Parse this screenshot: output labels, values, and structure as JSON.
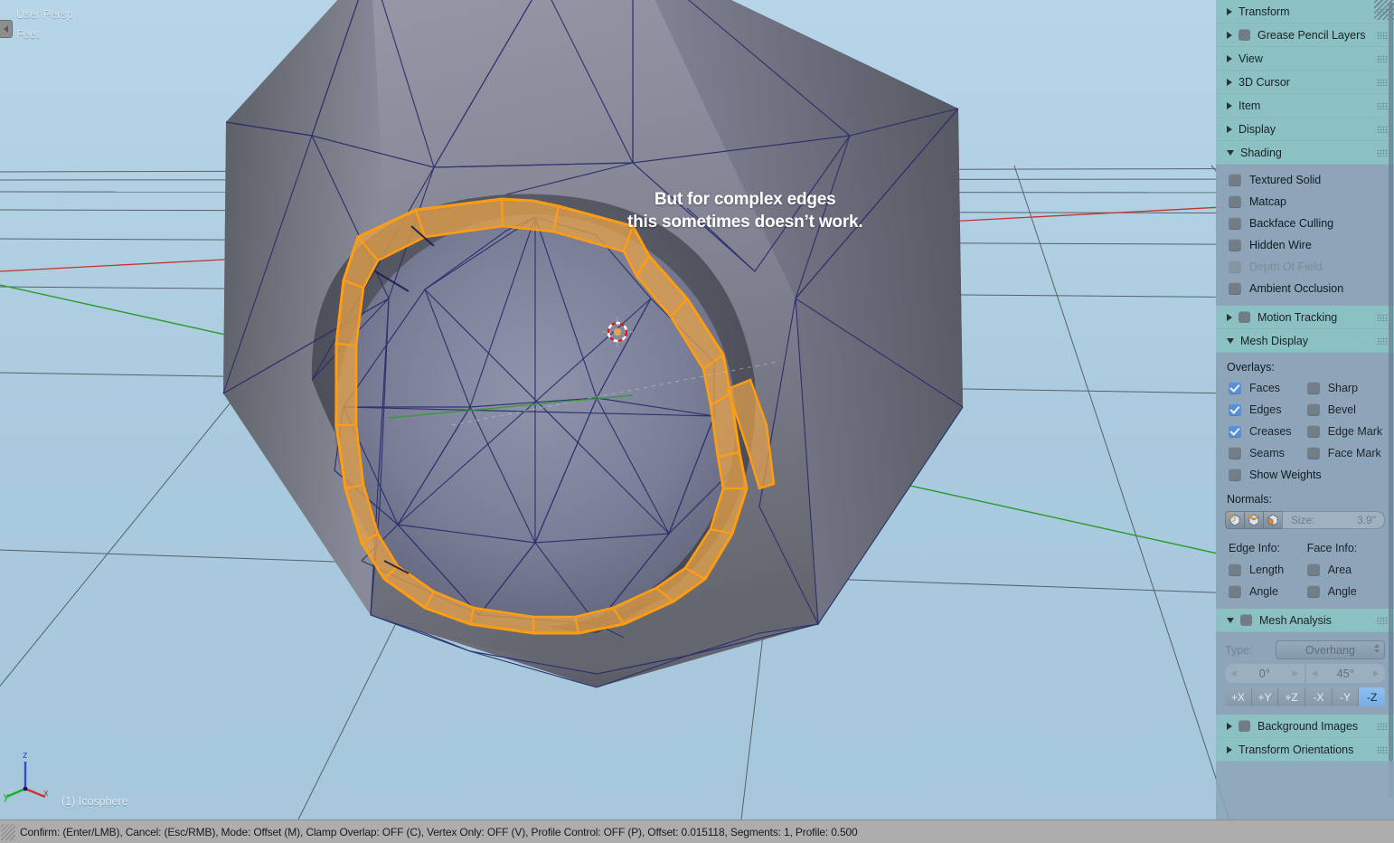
{
  "viewport": {
    "perspective_label": "User Persp",
    "units_label": "Feet",
    "object_name": "(1) Icosphere",
    "annotation_line1": "But for complex edges",
    "annotation_line2": "this sometimes doesn’t work.",
    "axis_gizmo": {
      "x": "x",
      "y": "y",
      "z": "z"
    },
    "colors": {
      "background_top": "#b7d5e9",
      "background_bottom": "#a6c7dc",
      "grid_line": "#4a4f52",
      "axis_x": "#c4332f",
      "axis_y": "#2e9c2e",
      "mesh_fill_light": "#8f92a3",
      "mesh_fill_dark": "#4e5059",
      "wire_edge": "#2a2f6b",
      "selected_edge": "#ff9d12",
      "selected_face": "#e8a34a"
    }
  },
  "properties_panel": {
    "panels": [
      {
        "name": "transform",
        "label": "Transform",
        "expanded": false,
        "has_checkbox": false
      },
      {
        "name": "grease-pencil-layers",
        "label": "Grease Pencil Layers",
        "expanded": false,
        "has_checkbox": true
      },
      {
        "name": "view",
        "label": "View",
        "expanded": false,
        "has_checkbox": false
      },
      {
        "name": "3d-cursor",
        "label": "3D Cursor",
        "expanded": false,
        "has_checkbox": false
      },
      {
        "name": "item",
        "label": "Item",
        "expanded": false,
        "has_checkbox": false
      },
      {
        "name": "display",
        "label": "Display",
        "expanded": false,
        "has_checkbox": false
      },
      {
        "name": "shading",
        "label": "Shading",
        "expanded": true,
        "has_checkbox": false
      },
      {
        "name": "motion-tracking",
        "label": "Motion Tracking",
        "expanded": false,
        "has_checkbox": true
      },
      {
        "name": "mesh-display",
        "label": "Mesh Display",
        "expanded": true,
        "has_checkbox": false
      },
      {
        "name": "mesh-analysis",
        "label": "Mesh Analysis",
        "expanded": true,
        "has_checkbox": true
      },
      {
        "name": "background-images",
        "label": "Background Images",
        "expanded": false,
        "has_checkbox": true
      },
      {
        "name": "transform-orientations",
        "label": "Transform Orientations",
        "expanded": false,
        "has_checkbox": false
      }
    ],
    "shading": {
      "options": [
        {
          "label": "Textured Solid",
          "checked": false,
          "disabled": false
        },
        {
          "label": "Matcap",
          "checked": false,
          "disabled": false
        },
        {
          "label": "Backface Culling",
          "checked": false,
          "disabled": false
        },
        {
          "label": "Hidden Wire",
          "checked": false,
          "disabled": false
        },
        {
          "label": "Depth Of Field",
          "checked": false,
          "disabled": true
        },
        {
          "label": "Ambient Occlusion",
          "checked": false,
          "disabled": false
        }
      ]
    },
    "mesh_display": {
      "overlays_label": "Overlays:",
      "overlays_left": [
        {
          "label": "Faces",
          "checked": true
        },
        {
          "label": "Edges",
          "checked": true
        },
        {
          "label": "Creases",
          "checked": true
        },
        {
          "label": "Seams",
          "checked": false
        }
      ],
      "overlays_right": [
        {
          "label": "Sharp",
          "checked": false
        },
        {
          "label": "Bevel",
          "checked": false
        },
        {
          "label": "Edge Mark",
          "checked": false
        },
        {
          "label": "Face Mark",
          "checked": false
        }
      ],
      "show_weights": {
        "label": "Show Weights",
        "checked": false
      },
      "normals_label": "Normals:",
      "normals_size_label": "Size:",
      "normals_size_value": "3.9\"",
      "edge_info_label": "Edge Info:",
      "face_info_label": "Face Info:",
      "edge_info": [
        {
          "label": "Length",
          "checked": false
        },
        {
          "label": "Angle",
          "checked": false
        }
      ],
      "face_info": [
        {
          "label": "Area",
          "checked": false
        },
        {
          "label": "Angle",
          "checked": false
        }
      ]
    },
    "mesh_analysis": {
      "type_label": "Type:",
      "type_value": "Overhang",
      "range_min": "0°",
      "range_max": "45°",
      "axis_buttons": [
        {
          "label": "+X",
          "active": false
        },
        {
          "label": "+Y",
          "active": false
        },
        {
          "label": "+Z",
          "active": false
        },
        {
          "label": "-X",
          "active": false
        },
        {
          "label": "-Y",
          "active": false
        },
        {
          "label": "-Z",
          "active": true
        }
      ]
    }
  },
  "status_bar": {
    "text": "Confirm: (Enter/LMB), Cancel: (Esc/RMB), Mode: Offset (M), Clamp Overlap: OFF (C), Vertex Only: OFF (V), Profile Control: OFF (P), Offset: 0.015118, Segments: 1, Profile: 0.500"
  }
}
